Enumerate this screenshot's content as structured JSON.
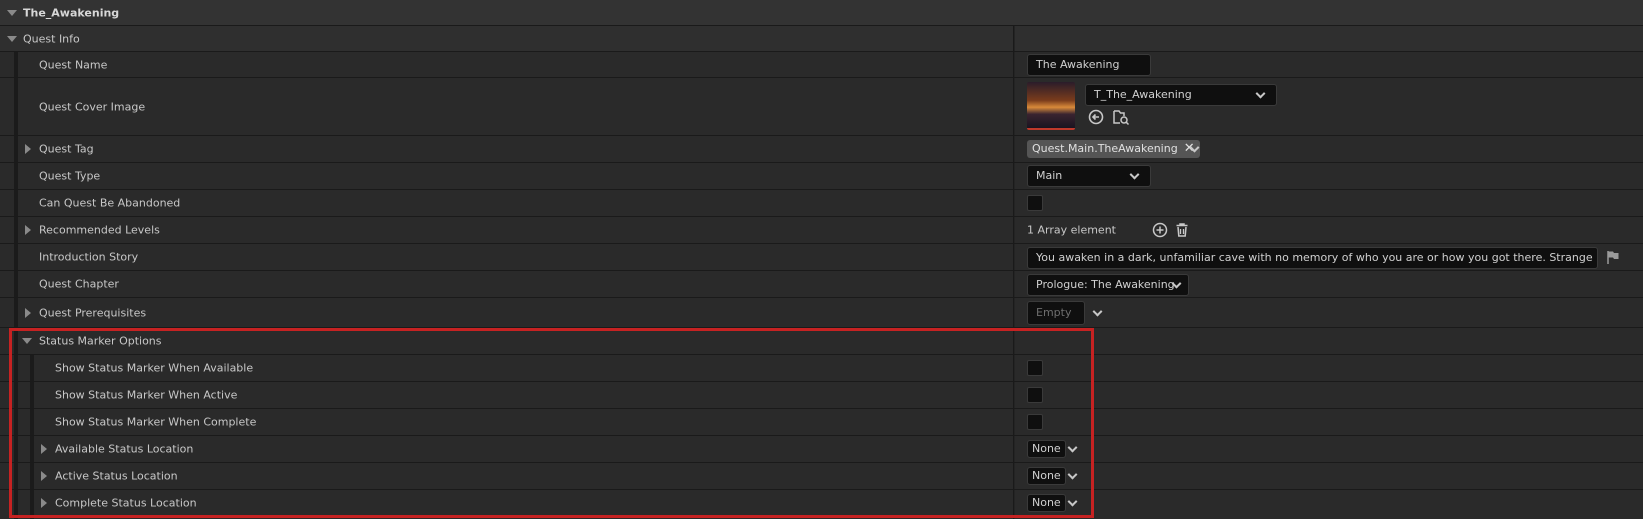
{
  "top_title": "The_Awakening",
  "section": {
    "label": "Quest Info",
    "rows": {
      "quest_name": {
        "label": "Quest Name",
        "value": "The Awakening"
      },
      "quest_cover_image": {
        "label": "Quest Cover Image",
        "asset": "T_The_Awakening"
      },
      "quest_tag": {
        "label": "Quest Tag",
        "tag": "Quest.Main.TheAwakening"
      },
      "quest_type": {
        "label": "Quest Type",
        "value": "Main"
      },
      "can_abandon": {
        "label": "Can Quest Be Abandoned"
      },
      "recommended_levels": {
        "label": "Recommended Levels",
        "value": "1 Array element"
      },
      "intro_story": {
        "label": "Introduction Story",
        "value": "You awaken in a dark, unfamiliar cave with no memory of who you are or how you got there. Strange markings c"
      },
      "quest_chapter": {
        "label": "Quest Chapter",
        "value": "Prologue: The Awakening"
      },
      "quest_prereqs": {
        "label": "Quest Prerequisites",
        "placeholder": "Empty"
      }
    }
  },
  "status_marker": {
    "label": "Status Marker Options",
    "rows": {
      "show_available": {
        "label": "Show Status Marker When Available"
      },
      "show_active": {
        "label": "Show Status Marker When Active"
      },
      "show_complete": {
        "label": "Show Status Marker When Complete"
      },
      "available_location": {
        "label": "Available Status Location",
        "value": "None"
      },
      "active_location": {
        "label": "Active Status Location",
        "value": "None"
      },
      "complete_location": {
        "label": "Complete Status Location",
        "value": "None"
      }
    }
  },
  "colors": {
    "highlight": "#c62222",
    "background": "#242424",
    "row": "#2a2a2a"
  }
}
